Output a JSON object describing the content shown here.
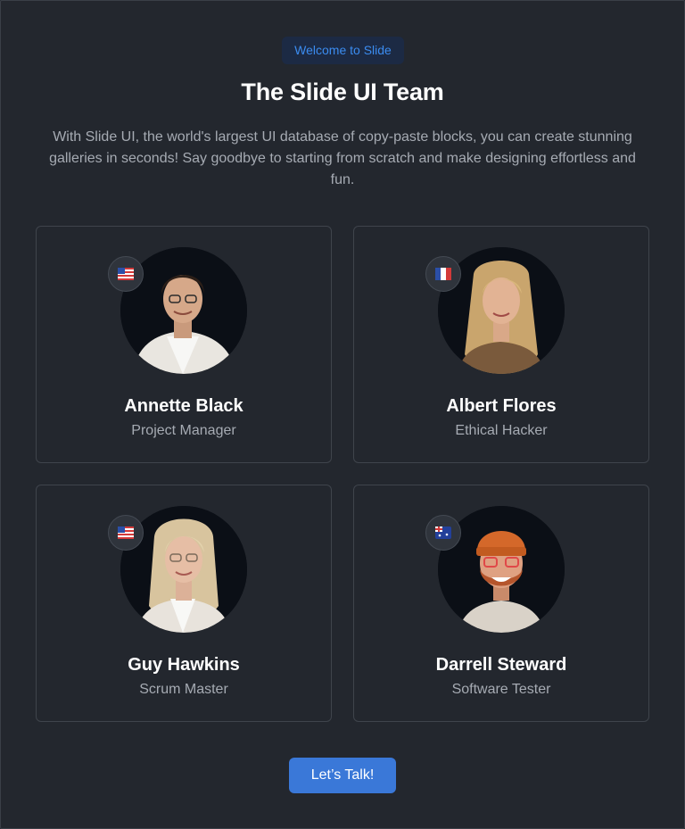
{
  "header": {
    "badge": "Welcome to Slide",
    "title": "The Slide UI Team",
    "description": "With Slide UI, the world's largest UI database of copy-paste blocks, you can create stunning galleries in seconds! Say goodbye to starting from scratch and make designing effortless and fun."
  },
  "team": [
    {
      "name": "Annette Black",
      "role": "Project Manager",
      "flag": "us-flag-icon"
    },
    {
      "name": "Albert Flores",
      "role": "Ethical Hacker",
      "flag": "france-flag-icon"
    },
    {
      "name": "Guy Hawkins",
      "role": "Scrum Master",
      "flag": "us-flag-icon"
    },
    {
      "name": "Darrell Steward",
      "role": "Software Tester",
      "flag": "australia-flag-icon"
    }
  ],
  "cta": {
    "label": "Let’s Talk!"
  },
  "colors": {
    "background": "#23272e",
    "accent": "#3a78d8",
    "badge_text": "#3b8cf0",
    "badge_bg": "#1c2a44"
  }
}
